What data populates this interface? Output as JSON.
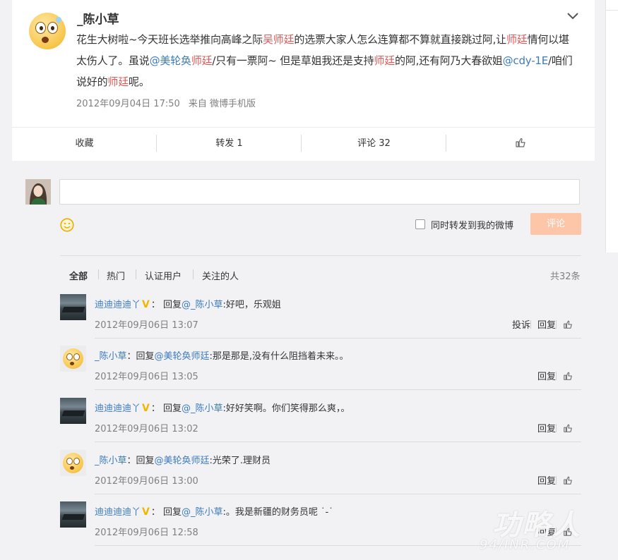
{
  "post": {
    "author": "_陈小草",
    "text_parts": [
      {
        "t": "花生大树啦~今天班长选举推向高峰之际",
        "k": "plain"
      },
      {
        "t": "吴师廷",
        "k": "hl"
      },
      {
        "t": "的选票大家人怎么连算都不算就直接跳过阿,让",
        "k": "plain"
      },
      {
        "t": "师廷",
        "k": "hl"
      },
      {
        "t": "情何以堪太伤人了。虽说",
        "k": "plain"
      },
      {
        "t": "@美轮奂",
        "k": "mention"
      },
      {
        "t": "师廷",
        "k": "hl"
      },
      {
        "t": "/只有一票阿~ 但是草姐我还是支持",
        "k": "plain"
      },
      {
        "t": "师廷",
        "k": "hl"
      },
      {
        "t": "的阿,还有阿乃大春欲姐",
        "k": "plain"
      },
      {
        "t": "@cdy-1E",
        "k": "mention"
      },
      {
        "t": "/咱们说好的",
        "k": "plain"
      },
      {
        "t": "师廷",
        "k": "hl"
      },
      {
        "t": "呢。",
        "k": "plain"
      }
    ],
    "time": "2012年09月04日 17:50",
    "source": "来自 微博手机版",
    "actions": {
      "collect": "收藏",
      "forward": "转发 1",
      "comment": "评论 32"
    }
  },
  "compose": {
    "placeholder": "",
    "forward_checkbox_label": "同时转发到我的微博",
    "submit_label": "评论"
  },
  "filter_tabs": [
    "全部",
    "热门",
    "认证用户",
    "关注的人"
  ],
  "total_count": "共32条",
  "comments": [
    {
      "user": "迪迪迪迪丫",
      "verified": true,
      "avatar": "lake",
      "reply_prefix": "：  回复",
      "reply_to": "@_陈小草",
      "text": ":好吧，乐观姐",
      "time": "2012年09月06日 13:07",
      "report": "投诉",
      "reply": "回复"
    },
    {
      "user": "_陈小草",
      "verified": false,
      "avatar": "face",
      "reply_prefix": "：回复",
      "reply_to": "@美轮奂师廷",
      "text": ":那是那是,没有什么阻挡着未来。。",
      "time": "2012年09月06日 13:05",
      "report": "",
      "reply": "回复"
    },
    {
      "user": "迪迪迪迪丫",
      "verified": true,
      "avatar": "lake",
      "reply_prefix": "：  回复",
      "reply_to": "@_陈小草",
      "text": ":好好笑啊。你们笑得那么爽，。",
      "time": "2012年09月06日 13:02",
      "report": "",
      "reply": "回复"
    },
    {
      "user": "_陈小草",
      "verified": false,
      "avatar": "face",
      "reply_prefix": "：回复",
      "reply_to": "@美轮奂师廷",
      "text": ":光荣了.理财员",
      "time": "2012年09月06日 13:00",
      "report": "",
      "reply": "回复"
    },
    {
      "user": "迪迪迪迪丫",
      "verified": true,
      "avatar": "lake",
      "reply_prefix": "：  回复",
      "reply_to": "@_陈小草",
      "text": ":。我是新疆的财务员呢 ˙-˙",
      "time": "2012年09月06日 12:58",
      "report": "",
      "reply": "回复"
    }
  ],
  "watermark": {
    "big": "功略人",
    "small": "94/INR.COM"
  },
  "colors": {
    "link": "#3b7bbd",
    "highlight": "#e05a5a",
    "submit": "#fdc6a9",
    "vip": "#f2b500"
  }
}
